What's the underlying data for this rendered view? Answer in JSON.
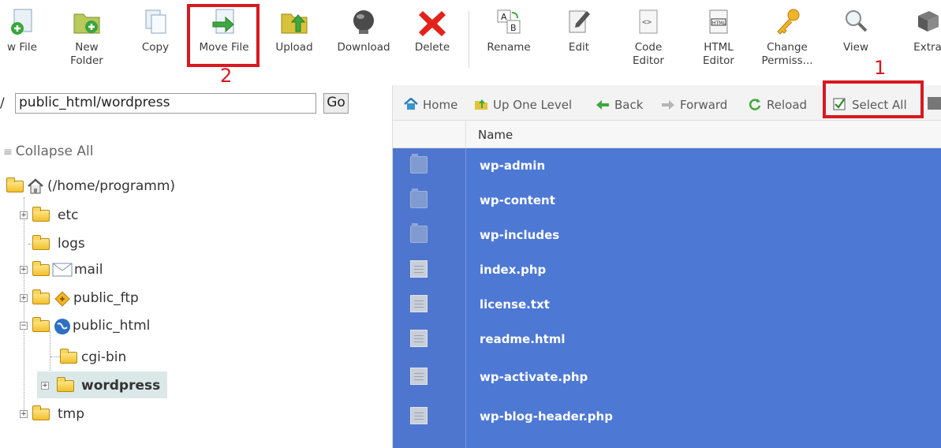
{
  "toolbar": {
    "buttons": [
      {
        "label": "w File"
      },
      {
        "label": "New\nFolder"
      },
      {
        "label": "Copy"
      },
      {
        "label": "Move File"
      },
      {
        "label": "Upload"
      },
      {
        "label": "Download"
      },
      {
        "label": "Delete"
      },
      {
        "label": "Rename"
      },
      {
        "label": "Edit"
      },
      {
        "label": "Code\nEditor"
      },
      {
        "label": "HTML\nEditor"
      },
      {
        "label": "Change\nPermiss..."
      },
      {
        "label": "View"
      },
      {
        "label": "Extra"
      }
    ]
  },
  "annotations": {
    "step1": "1",
    "step2": "2"
  },
  "left_pane": {
    "path_prefix": "/",
    "path_value": "public_html/wordpress",
    "go_label": "Go",
    "collapse_label": "Collapse All",
    "tree": [
      {
        "label": "(/home/programm)"
      },
      {
        "label": "etc"
      },
      {
        "label": "logs"
      },
      {
        "label": "mail"
      },
      {
        "label": "public_ftp"
      },
      {
        "label": "public_html"
      },
      {
        "label": "cgi-bin"
      },
      {
        "label": "wordpress"
      },
      {
        "label": "tmp"
      }
    ]
  },
  "right_pane": {
    "nav": {
      "home": "Home",
      "up": "Up One Level",
      "back": "Back",
      "forward": "Forward",
      "reload": "Reload",
      "select_all": "Select All"
    },
    "column_name": "Name",
    "files": [
      {
        "name": "wp-admin",
        "type": "folder"
      },
      {
        "name": "wp-content",
        "type": "folder"
      },
      {
        "name": "wp-includes",
        "type": "folder"
      },
      {
        "name": "index.php",
        "type": "file"
      },
      {
        "name": "license.txt",
        "type": "file"
      },
      {
        "name": "readme.html",
        "type": "file"
      },
      {
        "name": "wp-activate.php",
        "type": "file"
      },
      {
        "name": "wp-blog-header.php",
        "type": "file"
      }
    ]
  },
  "colors": {
    "highlight": "#d71920",
    "selection": "#4d78d4"
  }
}
